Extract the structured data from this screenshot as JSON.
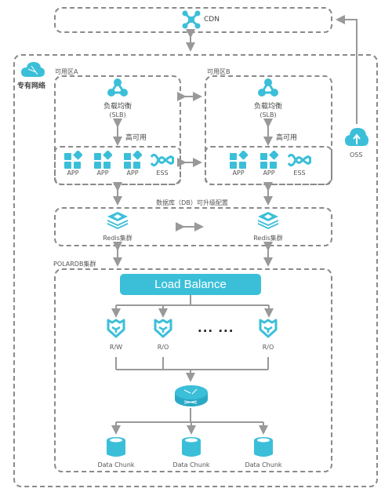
{
  "colors": {
    "icon": "#3bbfd9",
    "arrow": "#999999",
    "border": "#8a8a8a"
  },
  "cdn": {
    "label": "CDN",
    "icon": "cdn-network-icon"
  },
  "vpc": {
    "label": "专有网络",
    "icon": "vpc-cloud-icon"
  },
  "zone_a": {
    "label": "可用区A",
    "slb": {
      "name": "负载均衡",
      "sub": "(SLB)"
    },
    "ha_label": "高可用",
    "services": [
      "APP",
      "APP",
      "APP",
      "ESS"
    ]
  },
  "zone_b": {
    "label": "可用区B",
    "slb": {
      "name": "负载均衡",
      "sub": "(SLB)"
    },
    "ha_label": "高可用",
    "services": [
      "APP",
      "APP",
      "ESS"
    ]
  },
  "oss": {
    "label": "OSS"
  },
  "db_tier": {
    "label": "数据库（DB）可升级配置",
    "redis": [
      "Redis集群",
      "Redis集群"
    ]
  },
  "polardb": {
    "label": "POLARDB集群",
    "load_balance": "Load Balance",
    "nodes": [
      "R/W",
      "R/O",
      "R/O"
    ],
    "ellipsis": "... ...",
    "chunks": [
      "Data Chunk",
      "Data Chunk",
      "Data Chunk"
    ]
  }
}
